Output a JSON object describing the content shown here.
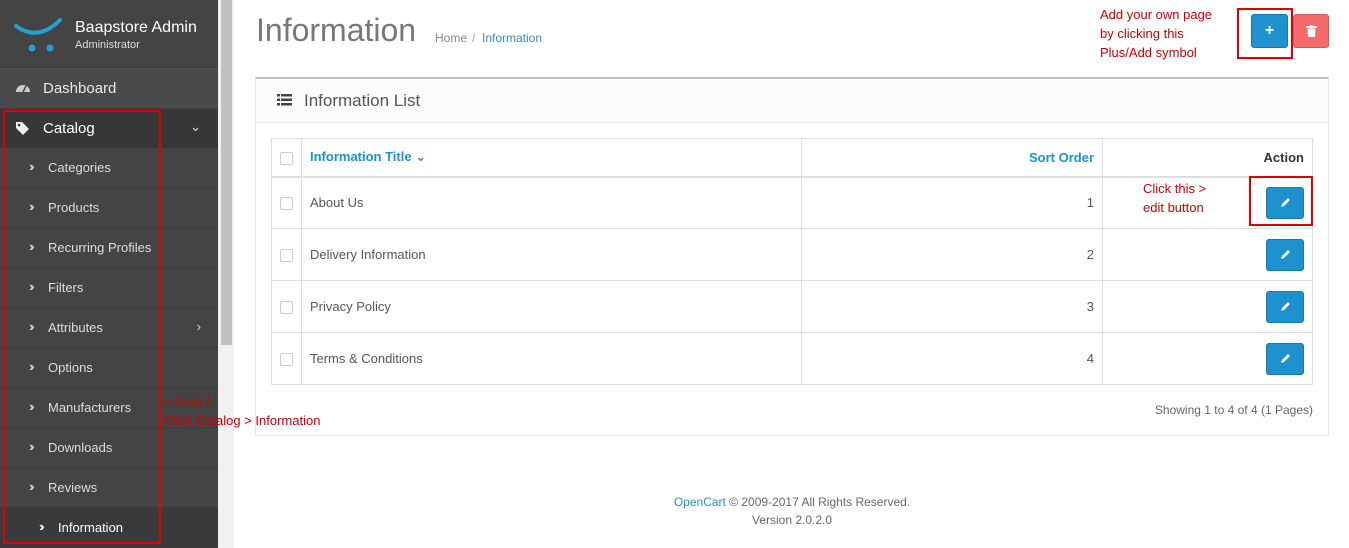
{
  "sidebar": {
    "brand_title": "Baapstore Admin",
    "brand_role": "Administrator",
    "dashboard_label": "Dashboard",
    "catalog_label": "Catalog",
    "catalog_items": [
      {
        "label": "Categories"
      },
      {
        "label": "Products"
      },
      {
        "label": "Recurring Profiles"
      },
      {
        "label": "Filters"
      },
      {
        "label": "Attributes"
      },
      {
        "label": "Options"
      },
      {
        "label": "Manufacturers"
      },
      {
        "label": "Downloads"
      },
      {
        "label": "Reviews"
      },
      {
        "label": "Information"
      }
    ]
  },
  "header": {
    "title": "Information",
    "breadcrumb": [
      "Home",
      "Information"
    ]
  },
  "panel": {
    "title": "Information List",
    "columns": {
      "title": "Information Title",
      "sort": "Sort Order",
      "action": "Action"
    },
    "rows": [
      {
        "title": "About Us",
        "sort_order": "1"
      },
      {
        "title": "Delivery Information",
        "sort_order": "2"
      },
      {
        "title": "Privacy Policy",
        "sort_order": "3"
      },
      {
        "title": "Terms & Conditions",
        "sort_order": "4"
      }
    ],
    "showing": "Showing 1 to 4 of 4 (1 Pages)"
  },
  "footer": {
    "link": "OpenCart",
    "copyright": " © 2009-2017 All Rights Reserved.",
    "version": "Version 2.0.2.0"
  },
  "annotations": {
    "add_hint": [
      "Add your own page",
      "by clicking this",
      "Plus/Add symbol"
    ],
    "edit_hint": [
      "Click this >",
      "edit button"
    ],
    "step_hint": [
      "> Step 1",
      "Click Catalog > Information"
    ]
  },
  "colors": {
    "primary": "#1e91cf",
    "danger": "#f56b6b",
    "sidebar": "#515151",
    "annotation": "#e00000"
  },
  "icons": {
    "add": "plus-icon",
    "delete": "trash-icon",
    "edit": "pencil-icon",
    "list": "list-icon",
    "dashboard": "dashboard-icon",
    "catalog": "tags-icon"
  }
}
